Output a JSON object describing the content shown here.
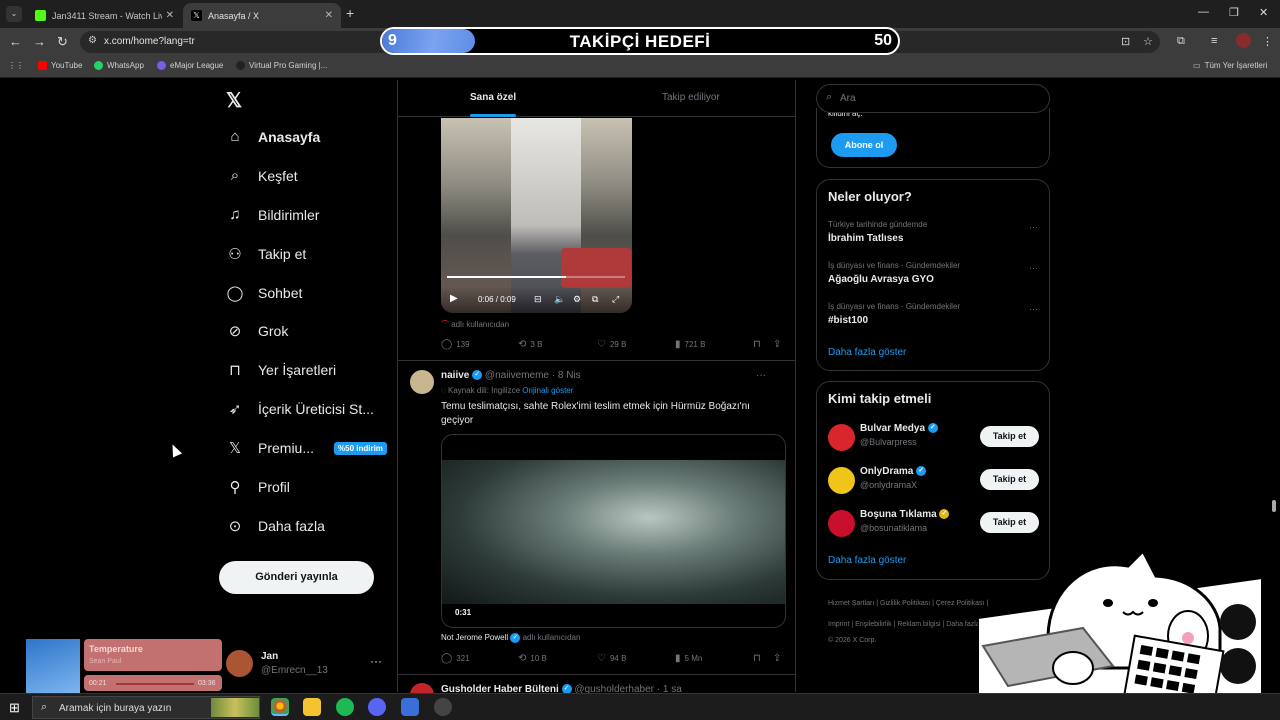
{
  "browser": {
    "tabs": [
      {
        "title": "Jan3411 Stream - Watch Live o",
        "color": "#53fc18"
      },
      {
        "title": "Anasayfa / X",
        "color": "#ffffff"
      }
    ],
    "url": "x.com/home?lang=tr",
    "bookmarks": [
      "YouTube",
      "WhatsApp",
      "eMajor League",
      "Virtual Pro Gaming |...",
      "Tüm Yer İşaretleri"
    ]
  },
  "goal": {
    "current": "9",
    "label": "TAKİPÇİ HEDEFİ",
    "target": "50",
    "progress_fraction": 0.18
  },
  "nav": {
    "items": [
      {
        "label": "Anasayfa",
        "icon": "home-icon"
      },
      {
        "label": "Keşfet",
        "icon": "search-icon"
      },
      {
        "label": "Bildirimler",
        "icon": "bell-icon"
      },
      {
        "label": "Takip et",
        "icon": "person-add-icon"
      },
      {
        "label": "Sohbet",
        "icon": "chat-icon"
      },
      {
        "label": "Grok",
        "icon": "grok-icon"
      },
      {
        "label": "Yer İşaretleri",
        "icon": "bookmark-icon"
      },
      {
        "label": "İçerik Üreticisi St...",
        "icon": "rocket-icon"
      },
      {
        "label": "Premiu...",
        "icon": "x-logo-icon"
      },
      {
        "label": "Profil",
        "icon": "profile-icon"
      },
      {
        "label": "Daha fazla",
        "icon": "more-circle-icon"
      }
    ],
    "premium_badge": "%50 indirim",
    "post_button": "Gönderi yayınla"
  },
  "account": {
    "name": "Jan",
    "handle": "@Emrecn__13"
  },
  "music": {
    "title": "Temperature",
    "artist": "Sean Paul",
    "elapsed": "00:21",
    "duration": "03:36",
    "progress_fraction": 0.1
  },
  "timeline": {
    "tabs": [
      "Sana özel",
      "Takip ediliyor"
    ],
    "tweet1": {
      "video_time": "0:06 / 0:09",
      "video_progress_fraction": 0.67,
      "source": "adlı kullanıcıdan",
      "replies": "139",
      "retweets": "3 B",
      "likes": "29 B",
      "views": "721 B"
    },
    "tweet2": {
      "name": "naiive",
      "handle": "@naiivememe",
      "time": "8 Nis",
      "source_lang": "Kaynak dili: İngilizce",
      "show_original": "Orijinali göster",
      "text": "Temu teslimatçısı, sahte Rolex'imi teslim etmek için Hürmüz Boğazı'nı geçiyor",
      "video_duration": "0:31",
      "credit_name": "Not Jerome Powell",
      "credit_suffix": "adlı kullanıcıdan",
      "replies": "321",
      "retweets": "10 B",
      "likes": "94 B",
      "views": "5 Mn"
    },
    "tweet3": {
      "name": "Gusholder Haber Bülteni",
      "handle": "@gusholderhaber",
      "time": "1 sa"
    }
  },
  "search": {
    "placeholder": "Ara"
  },
  "premium_card": {
    "cut_text": "kilidini aç.",
    "button": "Abone ol"
  },
  "trends": {
    "title": "Neler oluyor?",
    "items": [
      {
        "context": "Türkiye tarihinde gündemde",
        "name": "İbrahim Tatlıses"
      },
      {
        "context": "İş dünyası ve finans · Gündemdekiler",
        "name": "Ağaoğlu Avrasya GYO"
      },
      {
        "context": "İş dünyası ve finans · Gündemdekiler",
        "name": "#bist100"
      }
    ],
    "more": "Daha fazla göster"
  },
  "who_to_follow": {
    "title": "Kimi takip etmeli",
    "items": [
      {
        "name": "Bulvar Medya",
        "handle": "@Bulvarpress",
        "button": "Takip et",
        "badge": "blue",
        "avatar_color": "#d8262c"
      },
      {
        "name": "OnlyDrama",
        "handle": "@onlydramaX",
        "button": "Takip et",
        "badge": "blue",
        "avatar_color": "#f0c419"
      },
      {
        "name": "Boşuna Tıklama",
        "handle": "@bosunatiklama",
        "button": "Takip et",
        "badge": "gold",
        "avatar_color": "#c8102e"
      }
    ],
    "more": "Daha fazla göster"
  },
  "footer": {
    "line1": "Hizmet Şartları  |  Gizlilik Politikası  |  Çerez Politikası  |",
    "line2": "Imprint  |  Erişilebilirlik  |  Reklam bilgisi  |  Daha fazla ...",
    "line3": "© 2026 X Corp."
  },
  "taskbar": {
    "search_placeholder": "Aramak için buraya yazın"
  }
}
